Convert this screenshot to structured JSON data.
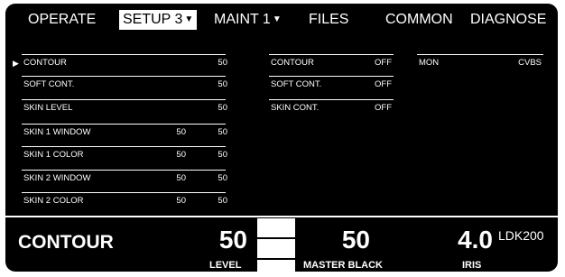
{
  "menu": {
    "tabs": [
      {
        "label": "OPERATE",
        "selected": false,
        "has_dropdown": false
      },
      {
        "label": "SETUP 3",
        "selected": true,
        "has_dropdown": true
      },
      {
        "label": "MAINT 1",
        "selected": false,
        "has_dropdown": true
      },
      {
        "label": "FILES",
        "selected": false,
        "has_dropdown": false
      },
      {
        "label": "COMMON",
        "selected": false,
        "has_dropdown": false
      },
      {
        "label": "DIAGNOSE",
        "selected": false,
        "has_dropdown": false
      }
    ],
    "dropdown_glyph": "▼"
  },
  "params": {
    "col1": [
      {
        "label": "CONTOUR",
        "value1": "",
        "value2": "50",
        "selected": true
      },
      {
        "label": "SOFT CONT.",
        "value1": "",
        "value2": "50"
      },
      {
        "label": "SKIN LEVEL",
        "value1": "",
        "value2": "50"
      },
      {
        "label": "SKIN 1 WINDOW",
        "value1": "50",
        "value2": "50"
      },
      {
        "label": "SKIN 1 COLOR",
        "value1": "50",
        "value2": "50"
      },
      {
        "label": "SKIN 2 WINDOW",
        "value1": "50",
        "value2": "50"
      },
      {
        "label": "SKIN 2 COLOR",
        "value1": "50",
        "value2": "50"
      }
    ],
    "col2": [
      {
        "label": "CONTOUR",
        "value": "OFF"
      },
      {
        "label": "SOFT CONT.",
        "value": "OFF"
      },
      {
        "label": "SKIN CONT.",
        "value": "OFF"
      }
    ],
    "col3": [
      {
        "label": "MON",
        "value": "CVBS"
      }
    ],
    "pointer_glyph": "▶"
  },
  "status": {
    "function_name": "CONTOUR",
    "level_value": "50",
    "level_label": "LEVEL",
    "master_black_value": "50",
    "master_black_label": "MASTER BLACK",
    "iris_value": "4.0",
    "iris_label": "IRIS",
    "model": "LDK200"
  }
}
